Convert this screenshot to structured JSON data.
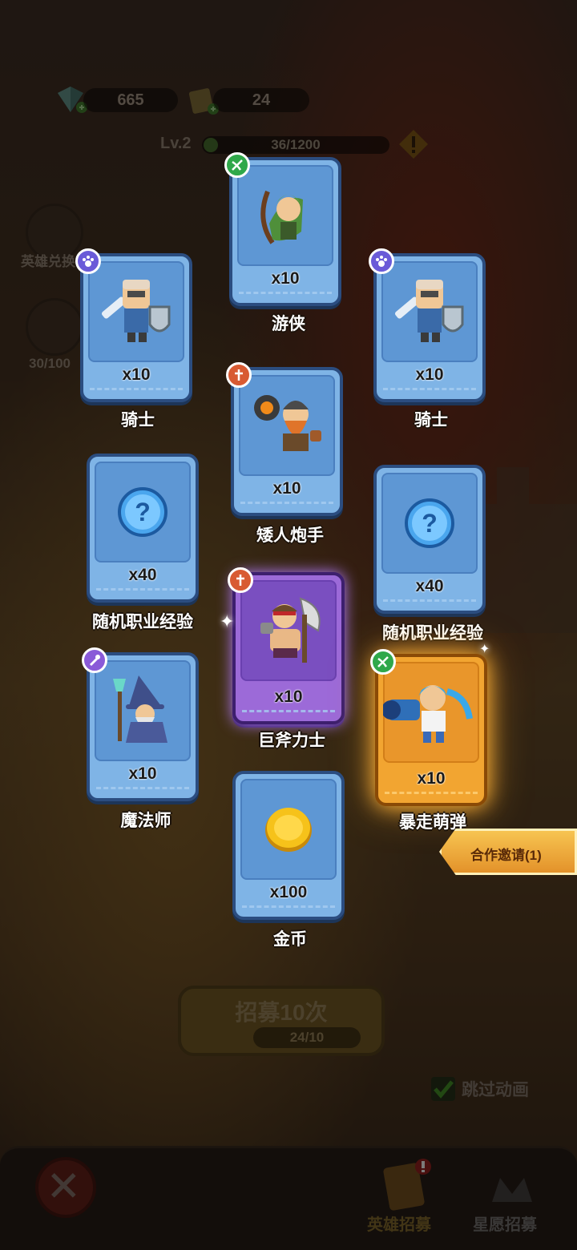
{
  "resources": {
    "gems": "665",
    "tickets": "24"
  },
  "level": {
    "label": "Lv.2",
    "progress_text": "36/1200",
    "progress": 0.03
  },
  "side": {
    "hero_exchange_label": "英雄兑换",
    "star_progress": "30/100"
  },
  "cards": [
    {
      "name": "游侠",
      "qty": "x10",
      "badge": "green",
      "art": "ranger-icon"
    },
    {
      "name": "骑士",
      "qty": "x10",
      "badge": "paw",
      "art": "knight-icon"
    },
    {
      "name": "骑士",
      "qty": "x10",
      "badge": "paw",
      "art": "knight-icon"
    },
    {
      "name": "矮人炮手",
      "qty": "x10",
      "badge": "red",
      "art": "dwarf-gunner-icon"
    },
    {
      "name": "随机职业经验",
      "qty": "x40",
      "badge": "",
      "art": "question-orb-icon"
    },
    {
      "name": "随机职业经验",
      "qty": "x40",
      "badge": "",
      "art": "question-orb-icon"
    },
    {
      "name": "巨斧力士",
      "qty": "x10",
      "badge": "red",
      "art": "axe-warrior-icon",
      "rarity": "purple"
    },
    {
      "name": "魔法师",
      "qty": "x10",
      "badge": "wand",
      "art": "wizard-icon"
    },
    {
      "name": "暴走萌弹",
      "qty": "x10",
      "badge": "green",
      "art": "cannon-girl-icon",
      "rarity": "gold"
    },
    {
      "name": "金币",
      "qty": "x100",
      "badge": "",
      "art": "gold-coin-icon"
    }
  ],
  "recruit": {
    "title": "招募10次",
    "count": "24/10"
  },
  "skip_animation": {
    "label": "跳过动画",
    "checked": true
  },
  "invite": {
    "label": "合作邀请(1)"
  },
  "nav": {
    "hero_recruit": "英雄招募",
    "star_recruit": "星愿招募"
  },
  "colors": {
    "common_card": "#7fb4e6",
    "epic_card": "#9c6ad8",
    "legendary_card": "#f2a531"
  }
}
